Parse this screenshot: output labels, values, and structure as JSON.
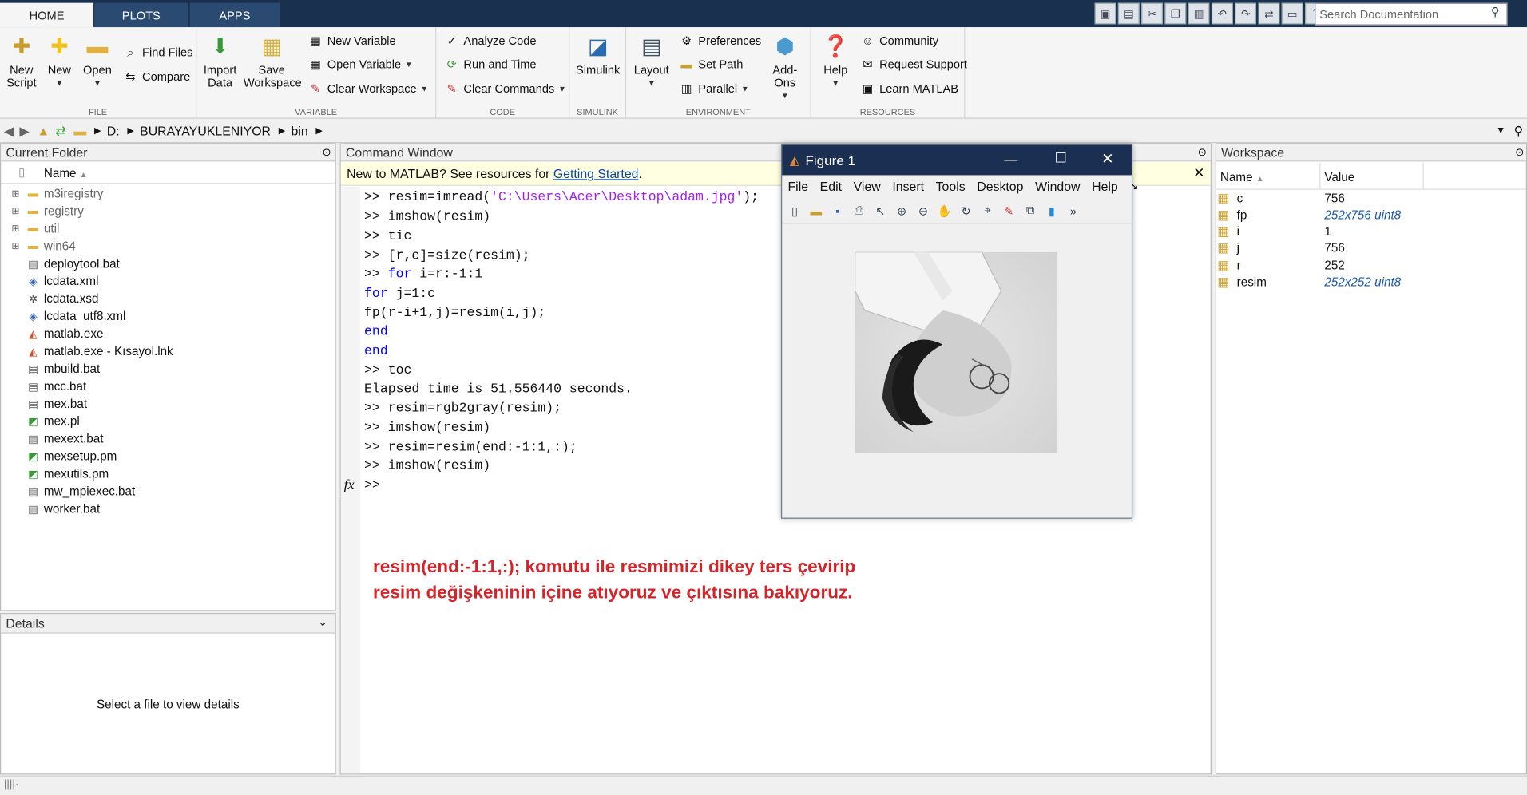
{
  "tabs": [
    "HOME",
    "PLOTS",
    "APPS"
  ],
  "search": {
    "placeholder": "Search Documentation"
  },
  "ribbon": {
    "file": {
      "label": "FILE",
      "new_script": "New\nScript",
      "new": "New",
      "open": "Open",
      "find_files": "Find Files",
      "compare": "Compare"
    },
    "variable": {
      "label": "VARIABLE",
      "import_data": "Import\nData",
      "save_workspace": "Save\nWorkspace",
      "new_variable": "New Variable",
      "open_variable": "Open Variable",
      "clear_workspace": "Clear Workspace"
    },
    "code": {
      "label": "CODE",
      "analyze_code": "Analyze Code",
      "run_and_time": "Run and Time",
      "clear_commands": "Clear Commands"
    },
    "simulink": {
      "label": "SIMULINK",
      "simulink": "Simulink"
    },
    "environment": {
      "label": "ENVIRONMENT",
      "layout": "Layout",
      "preferences": "Preferences",
      "set_path": "Set Path",
      "parallel": "Parallel",
      "add_ons": "Add-Ons"
    },
    "resources": {
      "label": "RESOURCES",
      "help": "Help",
      "community": "Community",
      "request_support": "Request Support",
      "learn_matlab": "Learn MATLAB"
    }
  },
  "path": [
    "D:",
    "BURAYAYUKLENIYOR",
    "bin"
  ],
  "current_folder": {
    "title": "Current Folder",
    "col_name": "Name",
    "items": [
      {
        "name": "m3iregistry",
        "type": "folder"
      },
      {
        "name": "registry",
        "type": "folder"
      },
      {
        "name": "util",
        "type": "folder"
      },
      {
        "name": "win64",
        "type": "folder"
      },
      {
        "name": "deploytool.bat",
        "type": "bat"
      },
      {
        "name": "lcdata.xml",
        "type": "xml"
      },
      {
        "name": "lcdata.xsd",
        "type": "xsd"
      },
      {
        "name": "lcdata_utf8.xml",
        "type": "xml"
      },
      {
        "name": "matlab.exe",
        "type": "matlab"
      },
      {
        "name": "matlab.exe - Kısayol.lnk",
        "type": "matlab"
      },
      {
        "name": "mbuild.bat",
        "type": "bat"
      },
      {
        "name": "mcc.bat",
        "type": "bat"
      },
      {
        "name": "mex.bat",
        "type": "bat"
      },
      {
        "name": "mex.pl",
        "type": "pl"
      },
      {
        "name": "mexext.bat",
        "type": "bat"
      },
      {
        "name": "mexsetup.pm",
        "type": "pl"
      },
      {
        "name": "mexutils.pm",
        "type": "pl"
      },
      {
        "name": "mw_mpiexec.bat",
        "type": "bat"
      },
      {
        "name": "worker.bat",
        "type": "bat"
      }
    ]
  },
  "details": {
    "title": "Details",
    "empty_text": "Select a file to view details"
  },
  "command_window": {
    "title": "Command Window",
    "banner_text": "New to MATLAB? See resources for ",
    "banner_link": "Getting Started",
    "banner_end": ".",
    "prompt": ">>"
  },
  "workspace": {
    "title": "Workspace",
    "col_name": "Name",
    "col_value": "Value",
    "vars": [
      {
        "name": "c",
        "value": "756",
        "italic": false
      },
      {
        "name": "fp",
        "value": "252x756 uint8",
        "italic": true
      },
      {
        "name": "i",
        "value": "1",
        "italic": false
      },
      {
        "name": "j",
        "value": "756",
        "italic": false
      },
      {
        "name": "r",
        "value": "252",
        "italic": false
      },
      {
        "name": "resim",
        "value": "252x252 uint8",
        "italic": true
      }
    ]
  },
  "figure": {
    "title": "Figure 1",
    "menus": [
      "File",
      "Edit",
      "View",
      "Insert",
      "Tools",
      "Desktop",
      "Window",
      "Help"
    ]
  },
  "annotation": "resim(end:-1:1,:); komutu ile resmimizi dikey ters çevirip resim değişkeninin içine atıyoruz ve çıktısına bakıyoruz.",
  "colors": {
    "titlebar": "#19304f",
    "annotation": "#d4242a",
    "string": "#a020f0",
    "keyword": "#0000ff"
  }
}
